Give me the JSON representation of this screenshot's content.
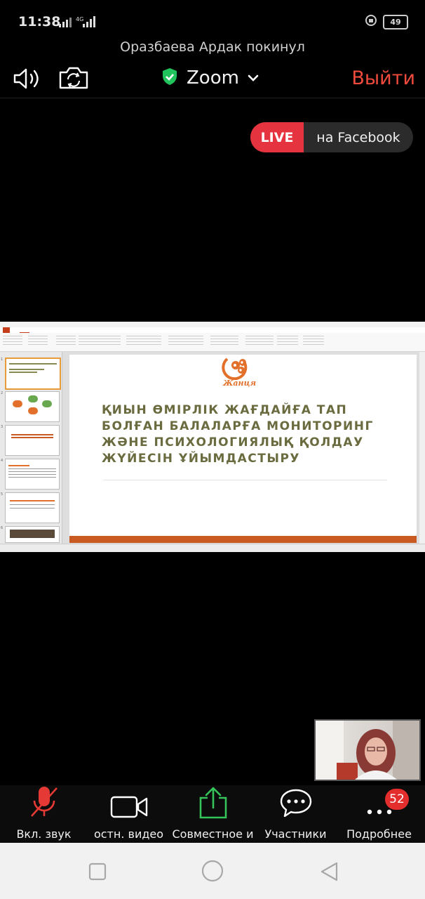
{
  "status_bar": {
    "time": "11:38",
    "network": "4G",
    "battery": "49"
  },
  "notification": "Оразбаева Ардак покинул",
  "header": {
    "app_name": "Zoom",
    "leave_label": "Выйти"
  },
  "live": {
    "badge": "LIVE",
    "destination": "на Facebook"
  },
  "shared_screen": {
    "app": "PowerPoint",
    "slide_logo_text": "Жанця",
    "slide_title": "ҚИЫН ӨМІРЛІК ЖАҒДАЙҒА ТАП БОЛҒАН БАЛАЛАРҒА МОНИТОРИНГ ЖӘНЕ ПСИХОЛОГИЯЛЫҚ ҚОЛДАУ ЖҮЙЕСІН ҰЙЫМДАСТЫРУ",
    "thumbnail_numbers": [
      "1",
      "2",
      "3",
      "4",
      "5",
      "6"
    ]
  },
  "toolbar": {
    "mute_label": "Вкл. звук",
    "video_label": "остн. видео",
    "share_label": "Совместное и",
    "participants_label": "Участники",
    "more_label": "Подробнее",
    "more_badge": "52"
  },
  "colors": {
    "leave": "#ef4a3c",
    "live": "#e5343f",
    "share_icon": "#35c45a",
    "muted_icon": "#e53935",
    "shield": "#21c45c",
    "slide_title": "#6b6b40",
    "slide_accent": "#e2702a"
  },
  "icons": [
    "signal-icon",
    "alarm-icon",
    "speaker-icon",
    "camera-switch-icon",
    "shield-check-icon",
    "chevron-down-icon",
    "microphone-muted-icon",
    "video-camera-icon",
    "share-arrow-icon",
    "chat-bubble-icon",
    "more-dots-icon",
    "nav-square-icon",
    "nav-circle-icon",
    "nav-back-icon"
  ]
}
